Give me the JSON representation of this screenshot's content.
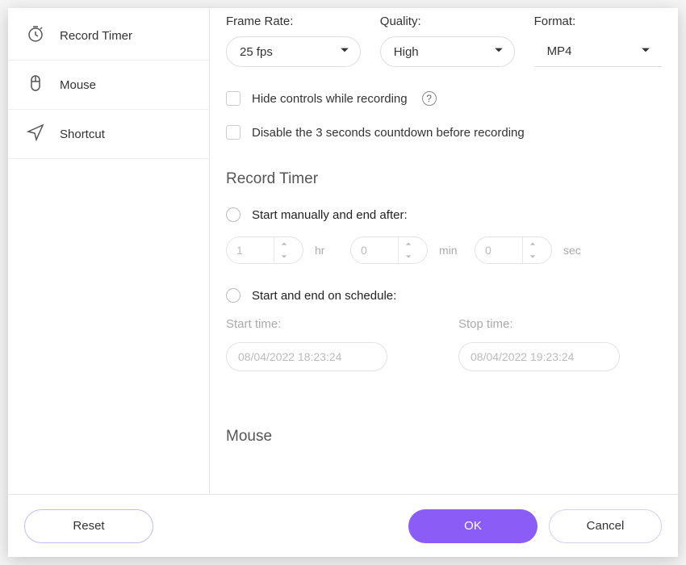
{
  "sidebar": {
    "items": [
      {
        "label": "Record Timer"
      },
      {
        "label": "Mouse"
      },
      {
        "label": "Shortcut"
      }
    ]
  },
  "top": {
    "frame_rate_label": "Frame Rate:",
    "frame_rate_value": "25 fps",
    "quality_label": "Quality:",
    "quality_value": "High",
    "format_label": "Format:",
    "format_value": "MP4"
  },
  "checkboxes": {
    "hide_controls": "Hide controls while recording",
    "disable_countdown": "Disable the 3 seconds countdown before recording"
  },
  "record_timer": {
    "title": "Record Timer",
    "radio_manual": "Start manually and end after:",
    "hr_value": "1",
    "hr_label": "hr",
    "min_value": "0",
    "min_label": "min",
    "sec_value": "0",
    "sec_label": "sec",
    "radio_schedule": "Start and end on schedule:",
    "start_label": "Start time:",
    "start_value": "08/04/2022 18:23:24",
    "stop_label": "Stop time:",
    "stop_value": "08/04/2022 19:23:24"
  },
  "mouse": {
    "title": "Mouse"
  },
  "footer": {
    "reset": "Reset",
    "ok": "OK",
    "cancel": "Cancel"
  }
}
